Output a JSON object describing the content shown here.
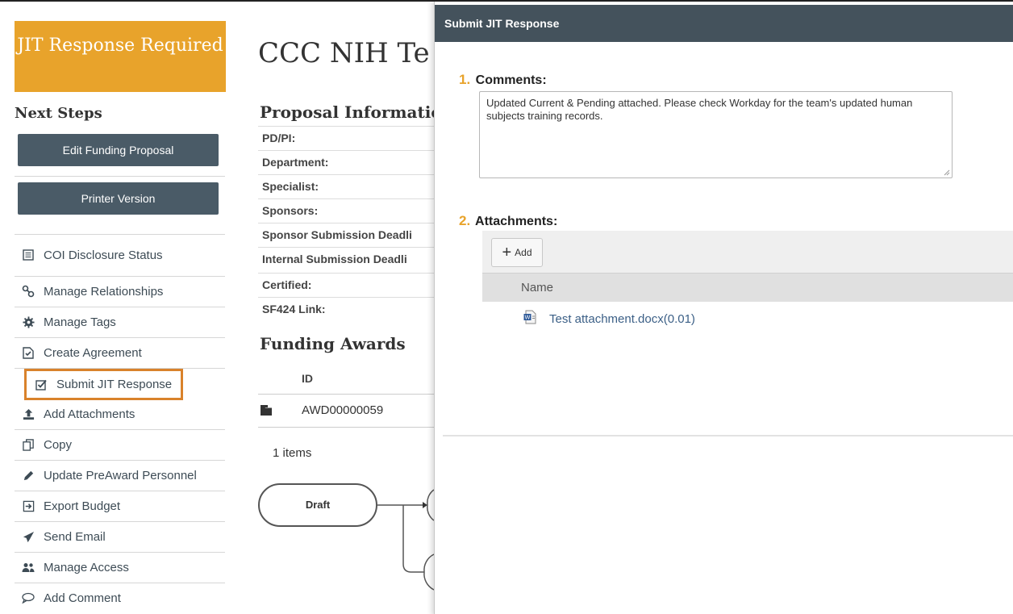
{
  "left": {
    "status": "JIT Response Required",
    "next_steps_title": "Next Steps",
    "edit_button": "Edit Funding Proposal",
    "printer_button": "Printer Version",
    "actions": [
      {
        "label": "COI Disclosure Status",
        "icon": "list-icon"
      },
      {
        "label": "Manage Relationships",
        "icon": "relationship-icon"
      },
      {
        "label": "Manage Tags",
        "icon": "gear-icon"
      },
      {
        "label": "Create Agreement",
        "icon": "agreement-icon"
      },
      {
        "label": "Submit JIT Response",
        "icon": "checkbox-icon"
      },
      {
        "label": "Add Attachments",
        "icon": "upload-icon"
      },
      {
        "label": "Copy",
        "icon": "copy-icon"
      },
      {
        "label": "Update PreAward Personnel",
        "icon": "pencil-icon"
      },
      {
        "label": "Export Budget",
        "icon": "export-icon"
      },
      {
        "label": "Send Email",
        "icon": "send-icon"
      },
      {
        "label": "Manage Access",
        "icon": "people-icon"
      },
      {
        "label": "Add Comment",
        "icon": "comment-icon"
      }
    ]
  },
  "main": {
    "title": "CCC NIH Te",
    "proposal_info_title": "Proposal Information",
    "fields": [
      "PD/PI:",
      "Department:",
      "Specialist:",
      "Sponsors:",
      "Sponsor Submission Deadli",
      "Internal Submission Deadli",
      "Certified:",
      "SF424 Link:"
    ],
    "awards_title": "Funding Awards",
    "awards_col_id": "ID",
    "award_id": "AWD00000059",
    "items_count": "1 items",
    "workflow_state": "Draft"
  },
  "dialog": {
    "title": "Submit JIT Response",
    "q1_num": "1.",
    "q1_label": "Comments:",
    "comments": "Updated Current & Pending attached. Please check Workday for the team's updated human subjects training records.",
    "q2_num": "2.",
    "q2_label": "Attachments:",
    "add_label": "Add",
    "grid_name_header": "Name",
    "attachment": "Test attachment.docx(0.01)"
  },
  "colors": {
    "accent": "#e8a32b",
    "header": "#44525c",
    "button": "#4a5b67",
    "highlight": "#d9822b"
  }
}
